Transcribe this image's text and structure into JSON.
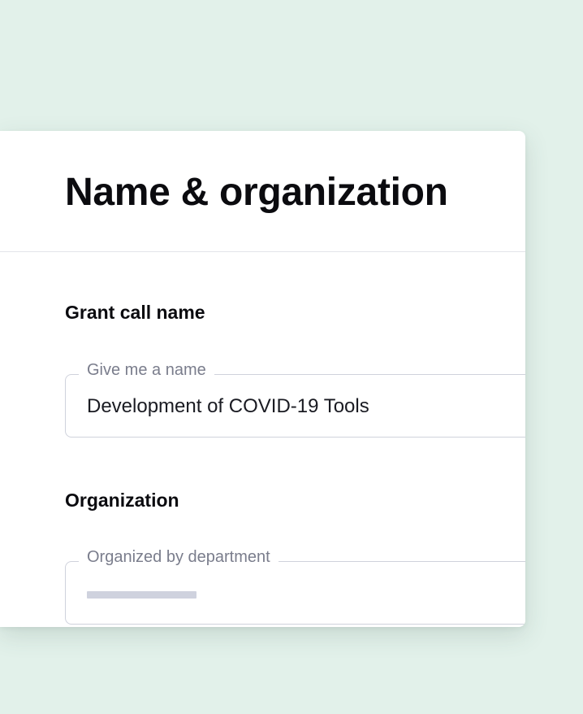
{
  "form": {
    "title": "Name & organization",
    "grant_call": {
      "section_label": "Grant call name",
      "field_label": "Give me a name",
      "value": "Development of COVID-19 Tools"
    },
    "organization": {
      "section_label": "Organization",
      "field_label": "Organized by department",
      "value_loading": true
    }
  },
  "colors": {
    "background": "#e2f1ea",
    "card": "#ffffff",
    "border": "#cfd2dc",
    "label_gray": "#7a7d8c",
    "skeleton": "#cfd2de"
  }
}
